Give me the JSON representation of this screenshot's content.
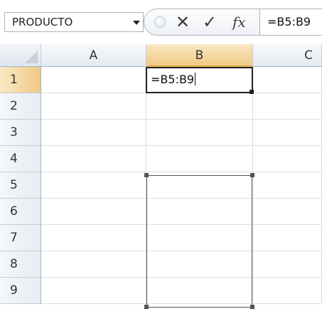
{
  "formula_bar": {
    "name_box": "PRODUCTO",
    "cancel_glyph": "✕",
    "enter_glyph": "✓",
    "fx_label": "fx",
    "formula": "=B5:B9"
  },
  "grid": {
    "columns": [
      "A",
      "B",
      "C"
    ],
    "rows": [
      "1",
      "2",
      "3",
      "4",
      "5",
      "6",
      "7",
      "8",
      "9"
    ],
    "active_cell": "B1",
    "active_cell_content": "=B5:B9",
    "referenced_range": "B5:B9"
  },
  "icons": {
    "name_box_dropdown": "chevron-down-icon",
    "insert_function": "fx-icon",
    "cancel": "close-icon",
    "enter": "check-icon"
  },
  "colors": {
    "active_header": "#f1c985",
    "header": "#e4eaf1",
    "gridline": "#d9dee6"
  }
}
